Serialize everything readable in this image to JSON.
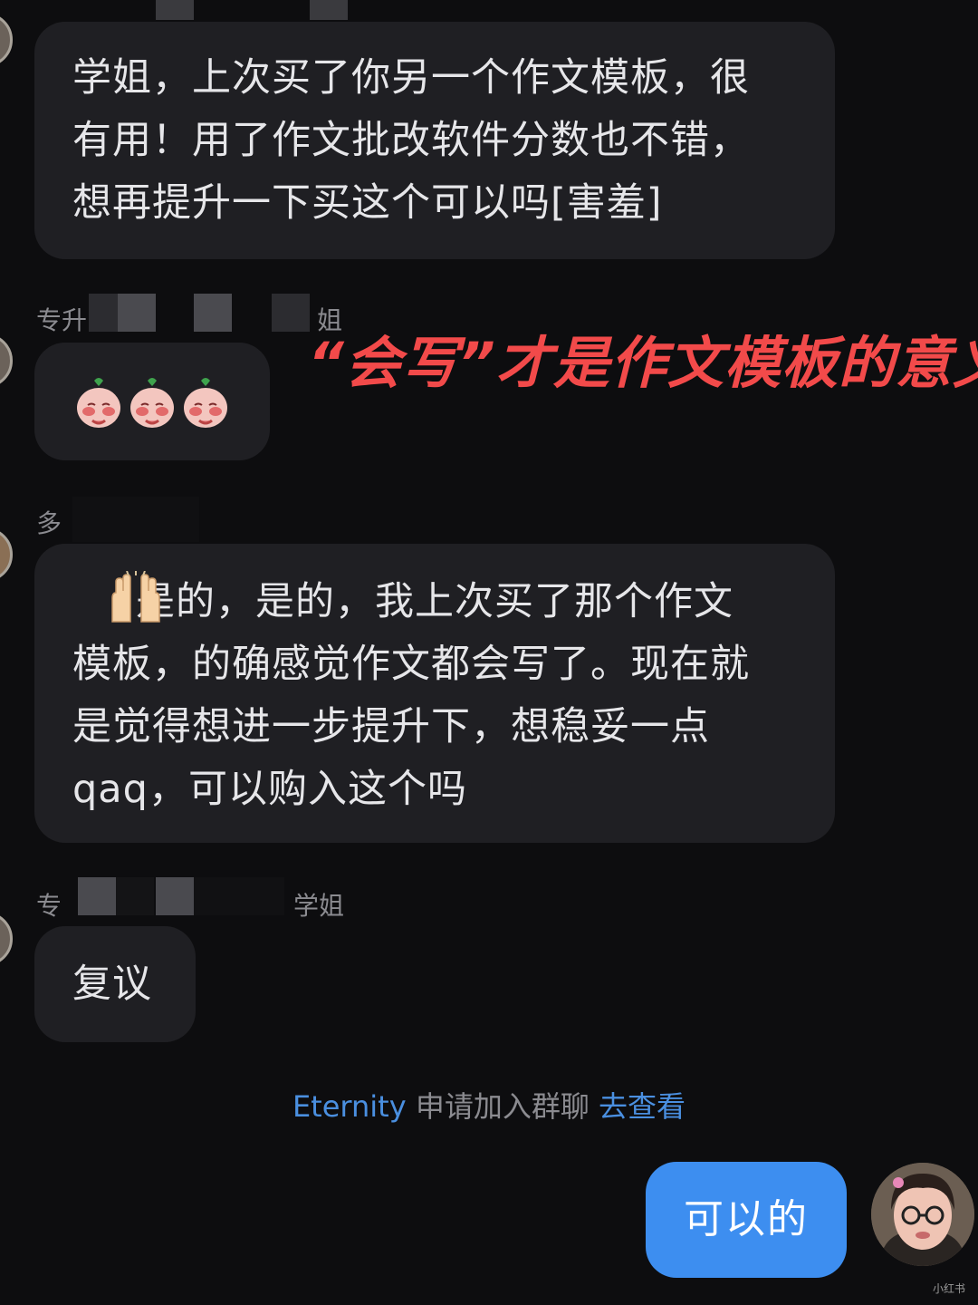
{
  "chat": {
    "messages": [
      {
        "text": "学姐，上次买了你另一个作文模板，很\n有用！用了作文批改软件分数也不错，\n想再提升一下买这个可以吗[害羞]"
      },
      {
        "sender_left": "专升",
        "sender_right": "姐",
        "sticker_name": "peach-pleading-sticker"
      },
      {
        "sender_left": "多",
        "text": "是的，是的，我上次买了那个作文\n模板，的确感觉作文都会写了。现在就\n是觉得想进一步提升下，想稳妥一点\nqaq，可以购入这个吗",
        "emoji_name": "raised-hands-icon"
      },
      {
        "sender_left": "专",
        "sender_right": "学姐",
        "text": "复议"
      }
    ],
    "system_notice": {
      "name": "Eternity",
      "text": " 申请加入群聊 ",
      "link": "去查看"
    },
    "my_message": "可以的",
    "my_avatar": "user-avatar",
    "overlay_caption": "“会写”才是作文模板的意义",
    "watermark": "小红书"
  },
  "colors": {
    "background": "#0d0d0f",
    "bubble": "#1f1f23",
    "my_bubble": "#3d8ef0",
    "link": "#4a8fe0",
    "caption": "#f24a4a"
  }
}
